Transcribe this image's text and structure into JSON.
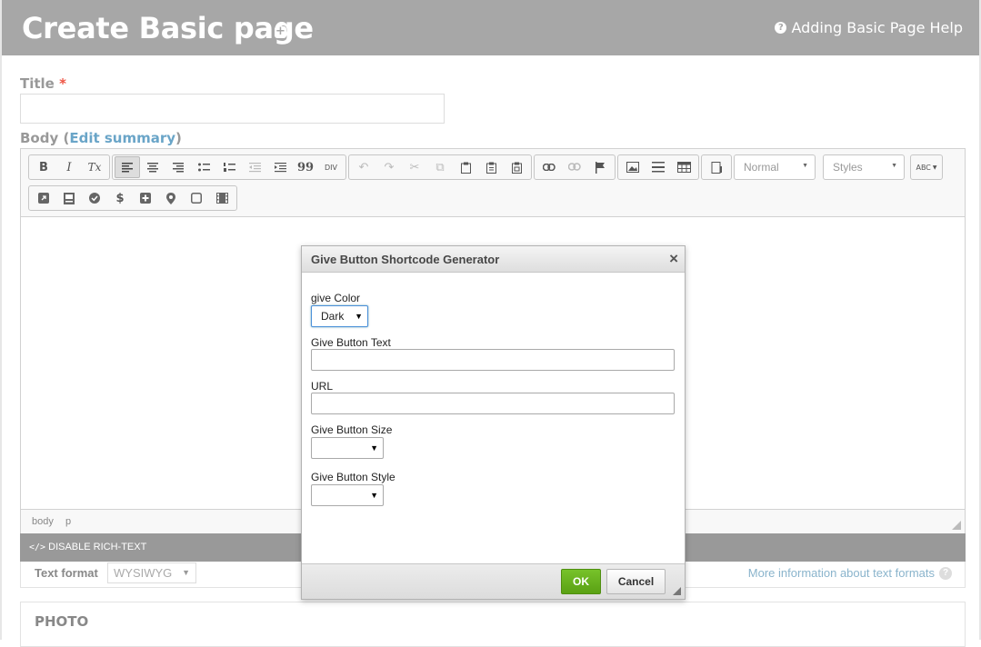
{
  "header": {
    "title": "Create Basic page",
    "add_icon": "plus-square-icon",
    "help_label": "Adding Basic Page Help",
    "help_icon": "question-circle-icon"
  },
  "form": {
    "title_label": "Title",
    "required_mark": "*",
    "title_value": "",
    "body_label": "Body",
    "body_open_paren": "(",
    "edit_summary_link": "Edit summary",
    "body_close_paren": ")"
  },
  "toolbar": {
    "bold": "B",
    "italic": "I",
    "remove_format": "Tx",
    "blockquote": "99",
    "div": "DIV",
    "format_combo": "Normal",
    "styles_combo": "Styles",
    "spellcheck": "ABC"
  },
  "editor": {
    "path": [
      "body",
      "p"
    ]
  },
  "disable_rich_text": "DISABLE RICH-TEXT",
  "text_format": {
    "label": "Text format",
    "value": "WYSIWYG",
    "info_link": "More information about text formats"
  },
  "photo": {
    "label": "PHOTO"
  },
  "dialog": {
    "title": "Give Button Shortcode Generator",
    "close": "×",
    "color_label": "give Color",
    "color_value": "Dark",
    "text_label": "Give Button Text",
    "text_value": "",
    "url_label": "URL",
    "url_value": "",
    "size_label": "Give Button Size",
    "size_value": "",
    "style_label": "Give Button Style",
    "style_value": "",
    "ok": "OK",
    "cancel": "Cancel"
  },
  "colors": {
    "header_bg": "#a7a7a7",
    "link": "#6aa5c8",
    "ok_button": "#5aa114"
  }
}
